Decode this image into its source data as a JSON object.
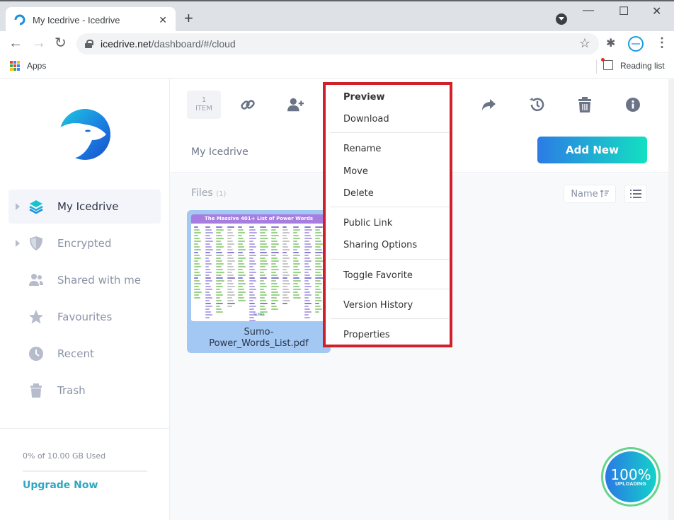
{
  "browser": {
    "tab_title": "My Icedrive - Icedrive",
    "new_tab_symbol": "+",
    "close_symbol": "✕",
    "url_host": "icedrive.net",
    "url_path": "/dashboard/#/cloud",
    "window_controls": {
      "minimize": "—",
      "maximize": "☐",
      "close": "✕"
    },
    "bookmarks": {
      "apps_label": "Apps",
      "reading_list_label": "Reading list"
    }
  },
  "sidebar": {
    "items": [
      {
        "label": "My Icedrive",
        "icon": "layers-icon",
        "active": true,
        "expandable": true
      },
      {
        "label": "Encrypted",
        "icon": "shield-icon",
        "active": false,
        "expandable": true
      },
      {
        "label": "Shared with me",
        "icon": "users-icon",
        "active": false,
        "expandable": false
      },
      {
        "label": "Favourites",
        "icon": "star-icon",
        "active": false,
        "expandable": false
      },
      {
        "label": "Recent",
        "icon": "clock-icon",
        "active": false,
        "expandable": false
      },
      {
        "label": "Trash",
        "icon": "trash-icon",
        "active": false,
        "expandable": false
      }
    ],
    "usage_text": "0% of 10.00 GB Used",
    "upgrade_label": "Upgrade Now"
  },
  "toolbar": {
    "selection_count": "1",
    "selection_unit": "ITEM",
    "icons": [
      "link-icon",
      "add-user-icon",
      "share-forward-icon",
      "history-icon",
      "trash-icon",
      "info-icon"
    ]
  },
  "header": {
    "breadcrumb": "My Icedrive",
    "add_new_label": "Add New"
  },
  "files": {
    "section_label": "Files",
    "count": "(1)",
    "sort_label": "Name",
    "items": [
      {
        "name_line1": "Sumo-",
        "name_line2": "Power_Words_List.pdf",
        "thumb_title": "The Massive 401+ List of Power Words",
        "thumb_footer": "SUMO"
      }
    ]
  },
  "context_menu": {
    "items": [
      {
        "label": "Preview",
        "bold": true
      },
      {
        "label": "Download"
      },
      {
        "label": "Rename"
      },
      {
        "label": "Move"
      },
      {
        "label": "Delete"
      },
      {
        "label": "Public Link"
      },
      {
        "label": "Sharing Options"
      },
      {
        "label": "Toggle Favorite"
      },
      {
        "label": "Version History"
      },
      {
        "label": "Properties"
      }
    ]
  },
  "upload_status": {
    "percent": "100%",
    "label": "UPLOADING"
  },
  "colors": {
    "accent": "#2fa7c1",
    "highlight_border": "#d0202c",
    "file_selected": "#a3c8f4",
    "upload_ring": "#63d48b"
  }
}
